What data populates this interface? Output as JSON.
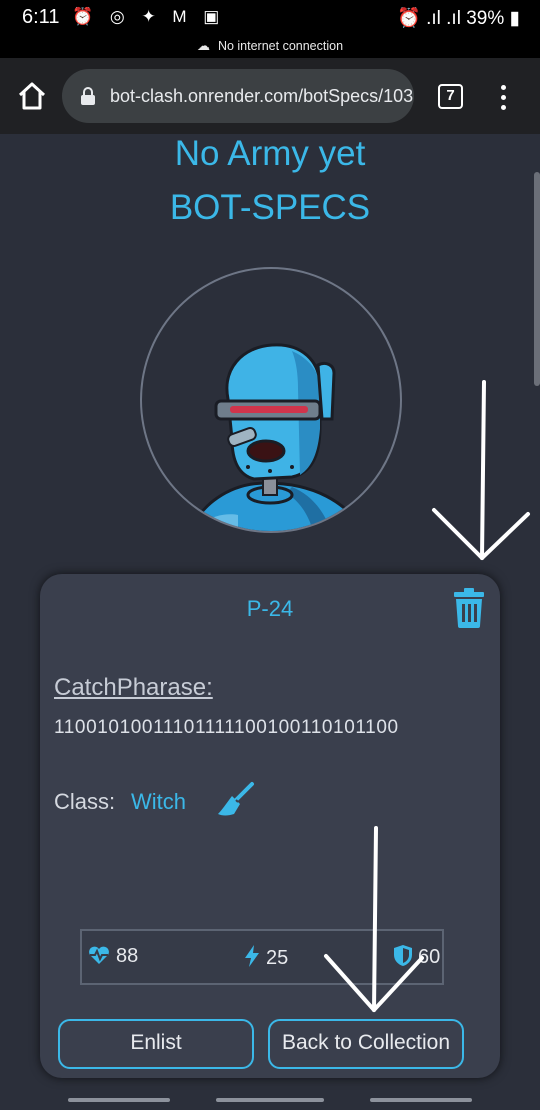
{
  "status_bar": {
    "time": "6:11",
    "left_icons": "⏰ ◎ ✦ M ▣",
    "signal": "⏰ .ıl .ıl",
    "battery": "39%",
    "offline_text": "No internet connection"
  },
  "browser": {
    "url": "bot-clash.onrender.com/botSpecs/103",
    "tab_count": "7"
  },
  "page": {
    "army_title": "No Army yet",
    "specs_title": "BOT-SPECS"
  },
  "card": {
    "id": "P-24",
    "catch_label": "CatchPharase:",
    "catch_value": "11001010011101111100100110101100",
    "class_label": "Class:",
    "class_value": "Witch",
    "stats": {
      "health": "88",
      "damage": "25",
      "armor": "60"
    },
    "enlist_label": "Enlist",
    "back_label": "Back to Collection"
  },
  "colors": {
    "accent": "#3bb8e8",
    "page_bg": "#2b2f3a",
    "card_bg": "#3a3f4d"
  }
}
